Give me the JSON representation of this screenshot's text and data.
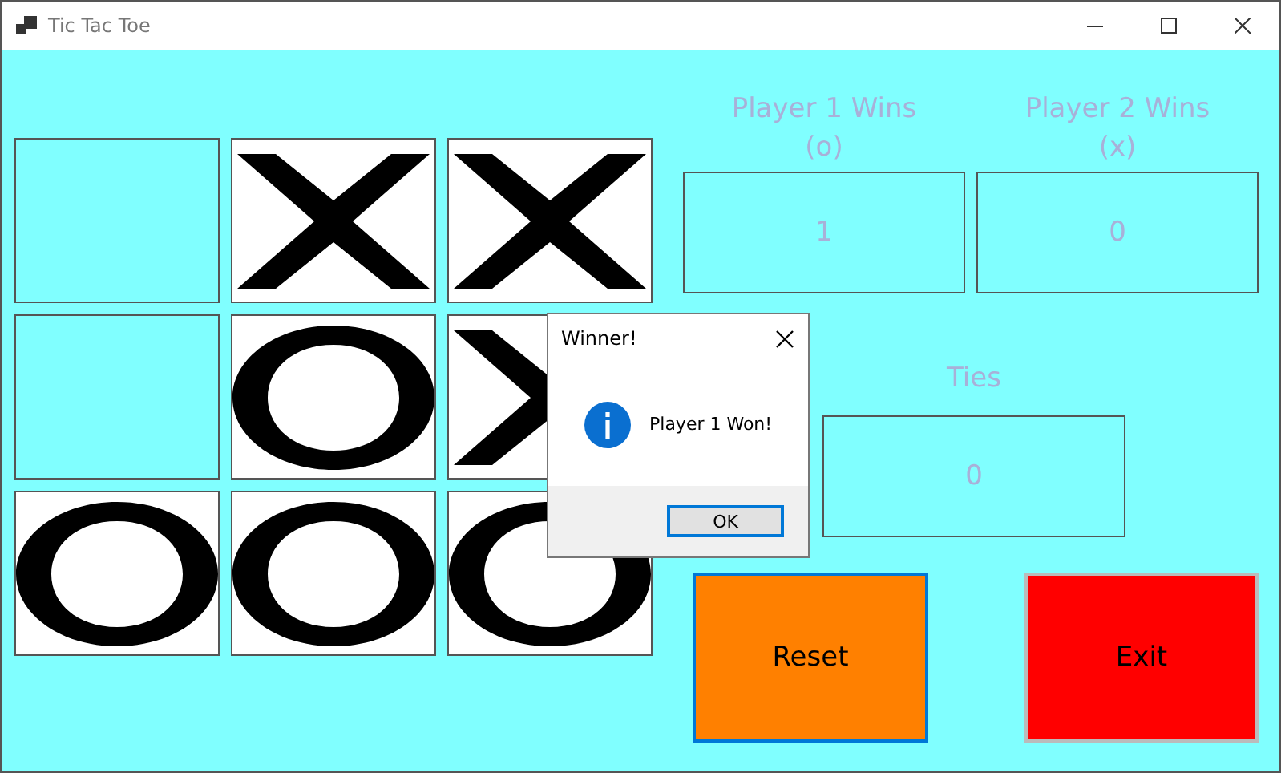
{
  "window": {
    "title": "Tic Tac Toe"
  },
  "board": {
    "cells": [
      {
        "kind": "empty"
      },
      {
        "kind": "x"
      },
      {
        "kind": "x"
      },
      {
        "kind": "empty"
      },
      {
        "kind": "o"
      },
      {
        "kind": "x"
      },
      {
        "kind": "o"
      },
      {
        "kind": "o"
      },
      {
        "kind": "o"
      }
    ]
  },
  "scores": [
    {
      "label": "Player 1 Wins",
      "symbol": "(o)",
      "value": "1"
    },
    {
      "label": "Player 2 Wins",
      "symbol": "(x)",
      "value": "0"
    }
  ],
  "ties": {
    "label": "Ties",
    "value": "0"
  },
  "buttons": [
    {
      "label": "Reset",
      "kind": "reset"
    },
    {
      "label": "Exit",
      "kind": "exit"
    }
  ],
  "dialog": {
    "title": "Winner!",
    "message": "Player 1 Won!",
    "button": "OK"
  }
}
